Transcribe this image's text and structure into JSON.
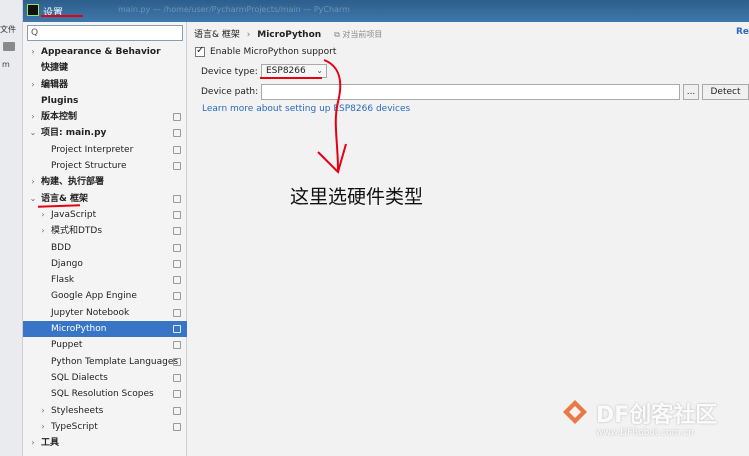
{
  "background": {
    "menu_label": "文件",
    "item_label": "m"
  },
  "titlebar": {
    "title": "设置",
    "blurred": "main.py — /home/user/PycharmProjects/main — PyCharm"
  },
  "sidebar": {
    "search_placeholder": "Q",
    "items": [
      {
        "label": "Appearance & Behavior"
      },
      {
        "label": "快捷键"
      },
      {
        "label": "编辑器"
      },
      {
        "label": "Plugins"
      },
      {
        "label": "版本控制"
      },
      {
        "label": "项目: main.py"
      },
      {
        "label": "Project Interpreter"
      },
      {
        "label": "Project Structure"
      },
      {
        "label": "构建、执行部署"
      },
      {
        "label": "语言& 框架"
      },
      {
        "label": "JavaScript"
      },
      {
        "label": "模式和DTDs"
      },
      {
        "label": "BDD"
      },
      {
        "label": "Django"
      },
      {
        "label": "Flask"
      },
      {
        "label": "Google App Engine"
      },
      {
        "label": "Jupyter Notebook"
      },
      {
        "label": "MicroPython"
      },
      {
        "label": "Puppet"
      },
      {
        "label": "Python Template Languages"
      },
      {
        "label": "SQL Dialects"
      },
      {
        "label": "SQL Resolution Scopes"
      },
      {
        "label": "Stylesheets"
      },
      {
        "label": "TypeScript"
      },
      {
        "label": "工具"
      }
    ]
  },
  "content": {
    "breadcrumb": {
      "parent": "语言& 框架",
      "separator": "›",
      "current": "MicroPython",
      "note": "对当前项目"
    },
    "reset_label": "Re",
    "enable_label": "Enable MicroPython support",
    "enable_checked": true,
    "check_mark": "✓",
    "device_type_label": "Device type:",
    "device_type_value": "ESP8266",
    "device_path_label": "Device path:",
    "device_path_value": "",
    "browse_label": "...",
    "detect_label": "Detect",
    "learn_link": "Learn more about setting up ESP8266 devices"
  },
  "annotation": {
    "text": "这里选硬件类型"
  },
  "watermark": {
    "brand": "DF创客社区",
    "url": "www.DFRobot.com.cn"
  },
  "colors": {
    "accent": "#3875c7",
    "link": "#2a6bbf",
    "annotation_red": "#e60012",
    "titlebar": "#2d5e8c"
  }
}
